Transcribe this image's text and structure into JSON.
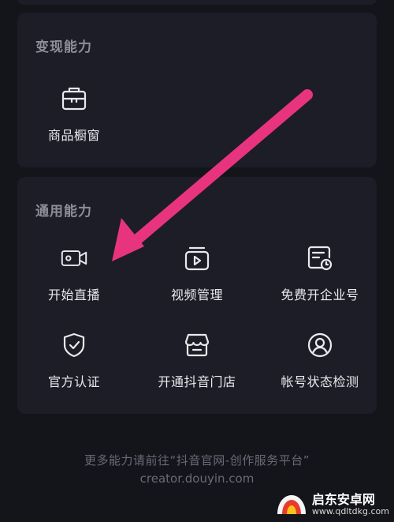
{
  "monetize": {
    "title": "变现能力",
    "items": [
      {
        "label": "商品橱窗",
        "icon": "shop-window-icon"
      }
    ]
  },
  "general": {
    "title": "通用能力",
    "items": [
      {
        "label": "开始直播",
        "icon": "live-camera-icon"
      },
      {
        "label": "视频管理",
        "icon": "video-manage-icon"
      },
      {
        "label": "免费开企业号",
        "icon": "enterprise-account-icon"
      },
      {
        "label": "官方认证",
        "icon": "shield-check-icon"
      },
      {
        "label": "开通抖音门店",
        "icon": "store-icon"
      },
      {
        "label": "帐号状态检测",
        "icon": "account-status-icon"
      }
    ]
  },
  "footer": {
    "hint": "更多能力请前往“抖音官网-创作服务平台”",
    "url": "creator.douyin.com"
  },
  "watermark": {
    "name": "启东安卓网",
    "domain": "www.qdltdkg.com"
  },
  "colors": {
    "background": "#14141b",
    "card": "#1d1d27",
    "arrow": "#e8347e",
    "label": "#e9e9ee",
    "muted": "#8e8e99"
  }
}
